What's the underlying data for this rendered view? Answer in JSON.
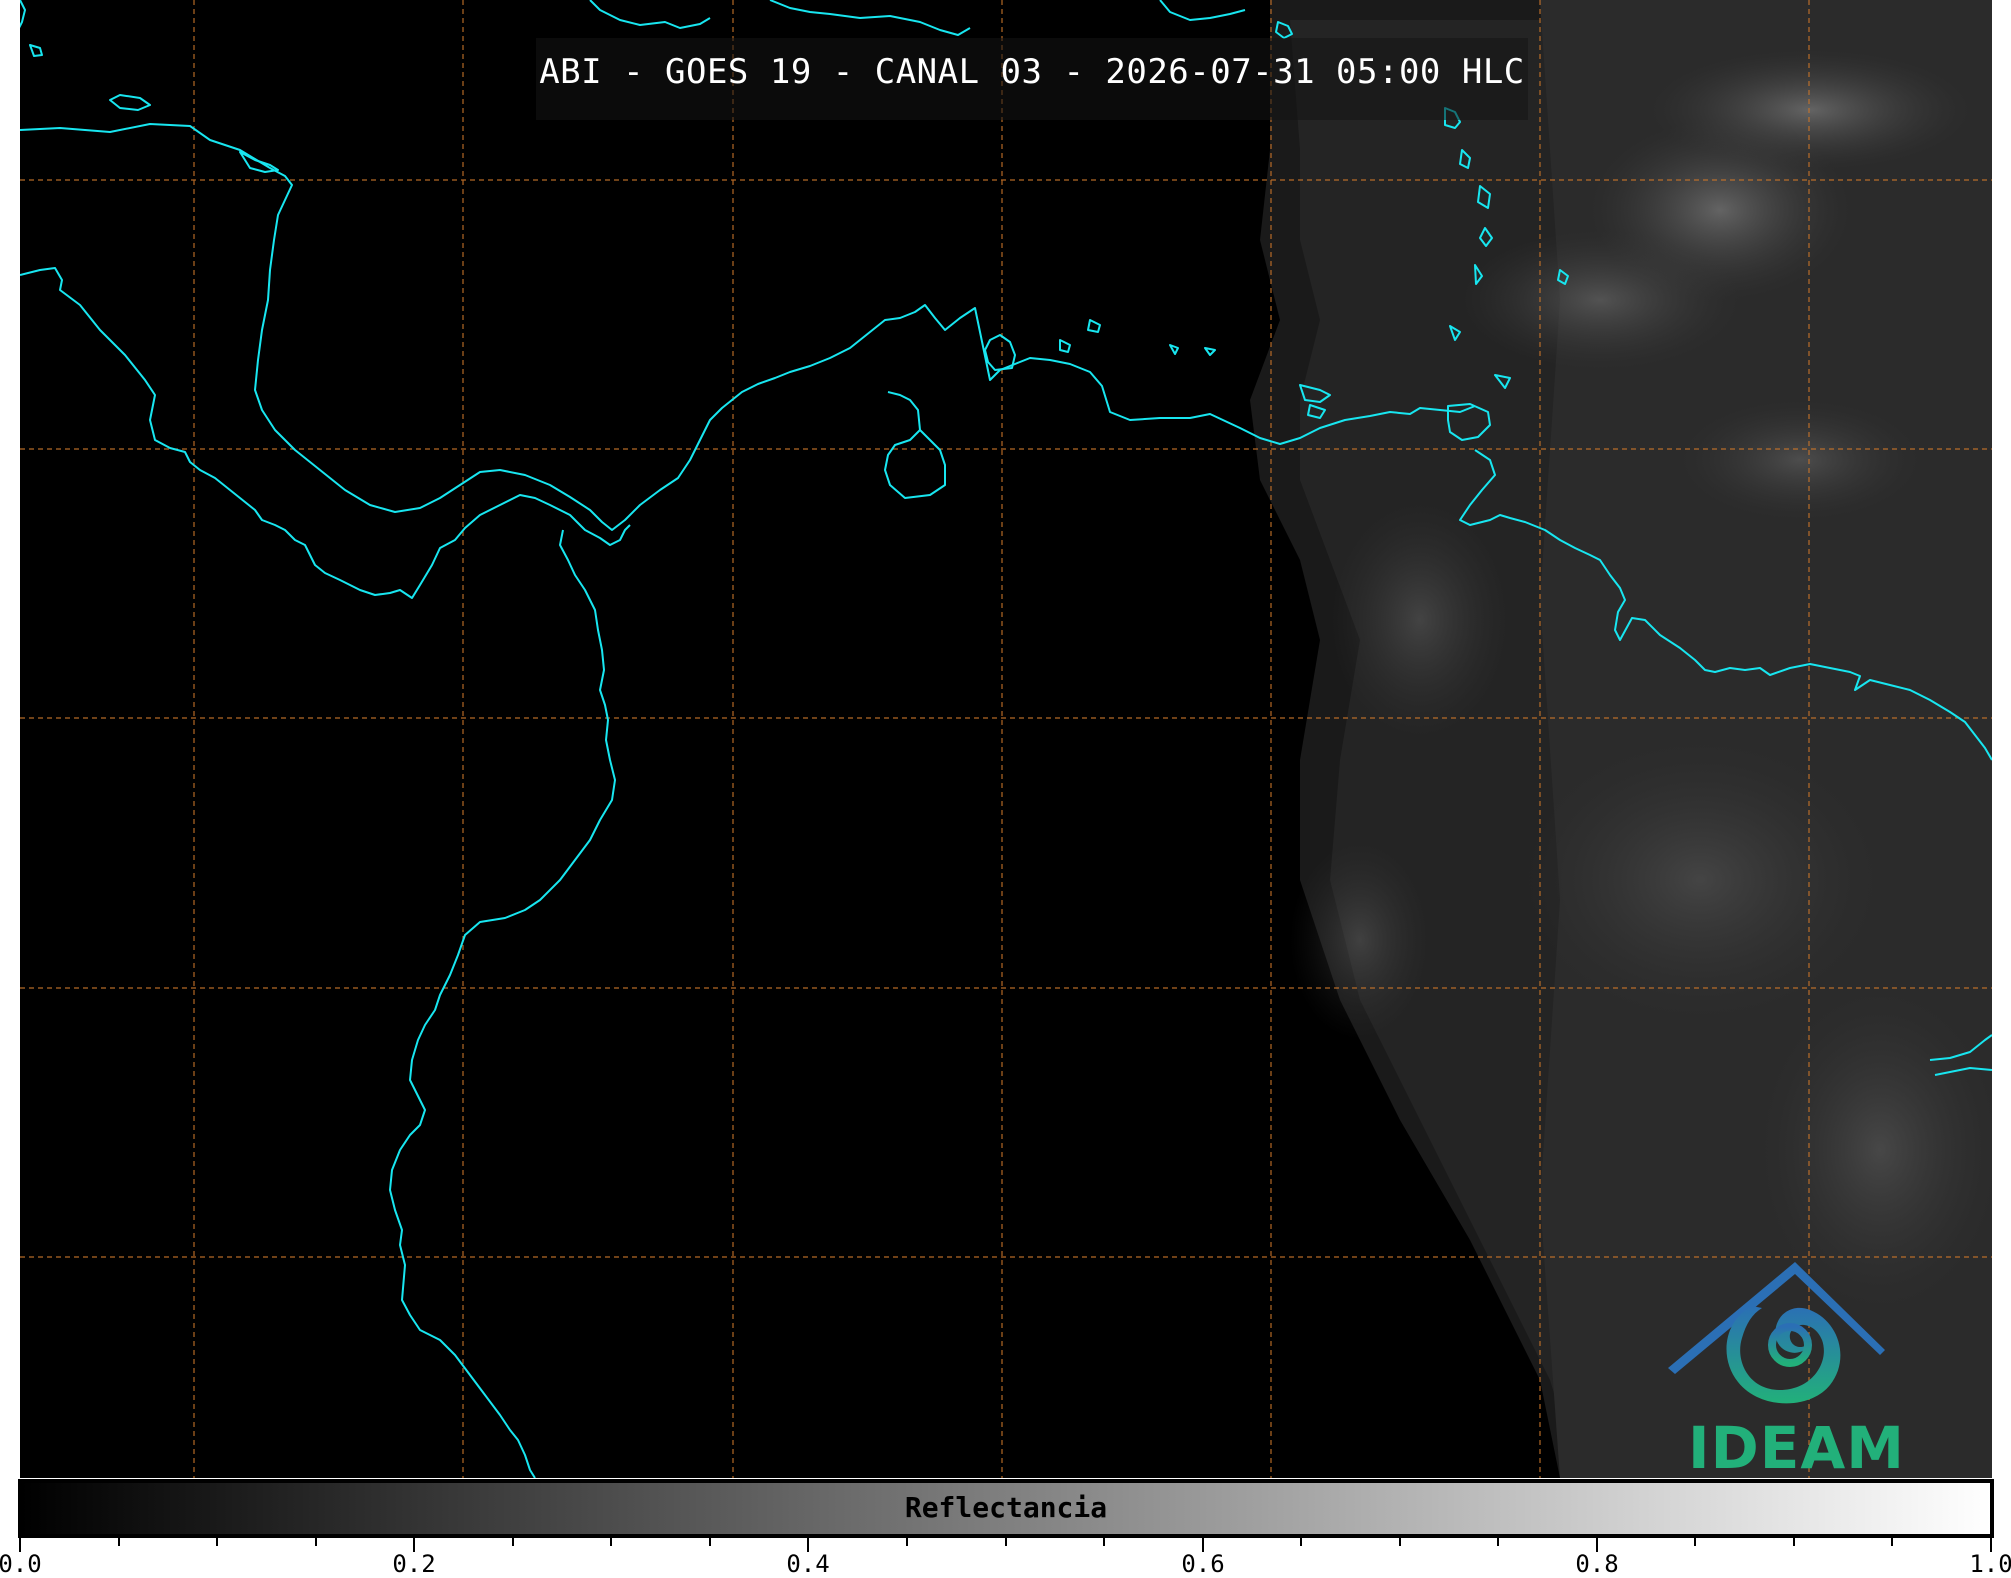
{
  "title": "ABI - GOES 19 - CANAL 03 - 2026-07-31 05:00 HLC",
  "colorbar": {
    "label": "Reflectancia",
    "ticks": [
      "0.0",
      "0.2",
      "0.4",
      "0.6",
      "0.8",
      "1.0"
    ],
    "range": [
      0.0,
      1.0
    ]
  },
  "logo": {
    "text": "IDEAM",
    "color": "#22b07a",
    "top_color": "#2b6fb5"
  },
  "colors": {
    "background": "#000000",
    "coastline": "#18e6f0",
    "gridline": "#c8742a"
  }
}
